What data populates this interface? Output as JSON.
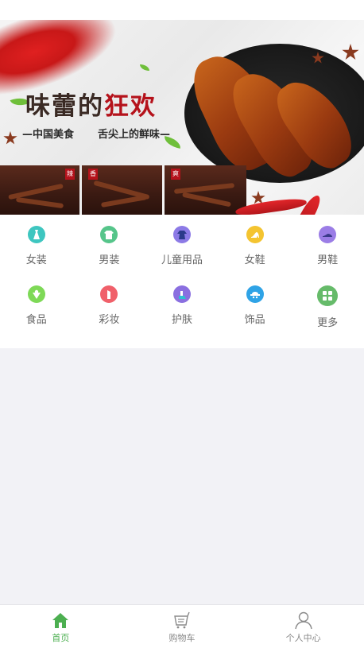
{
  "banner": {
    "title_part1": "味蕾的",
    "title_part2": "狂欢",
    "subtitle_left": "—中国美食",
    "subtitle_right": "舌尖上的鲜味—",
    "thumb_tags": [
      "辣",
      "香",
      "爽"
    ],
    "accent_color": "#b5121b"
  },
  "categories": [
    {
      "label": "女装",
      "icon": "dress-icon",
      "color": "#3ec6c0"
    },
    {
      "label": "男装",
      "icon": "shirt-icon",
      "color": "#56c58a"
    },
    {
      "label": "儿童用品",
      "icon": "kids-clothes-icon",
      "color": "#8c7ae6"
    },
    {
      "label": "女鞋",
      "icon": "high-heel-icon",
      "color": "#f4c430"
    },
    {
      "label": "男鞋",
      "icon": "shoe-icon",
      "color": "#9b7de6"
    },
    {
      "label": "食品",
      "icon": "food-icon",
      "color": "#7ed957"
    },
    {
      "label": "彩妆",
      "icon": "lipstick-icon",
      "color": "#f0606a"
    },
    {
      "label": "护肤",
      "icon": "skincare-icon",
      "color": "#8a6fe0"
    },
    {
      "label": "饰品",
      "icon": "hat-icon",
      "color": "#2fa3e6"
    },
    {
      "label": "更多",
      "icon": "more-grid-icon",
      "color": "#66bb6a"
    }
  ],
  "tabbar": {
    "items": [
      {
        "label": "首页",
        "icon": "home-icon",
        "active": true
      },
      {
        "label": "购物车",
        "icon": "cart-icon",
        "active": false
      },
      {
        "label": "个人中心",
        "icon": "user-icon",
        "active": false
      }
    ],
    "active_color": "#4caf50"
  }
}
